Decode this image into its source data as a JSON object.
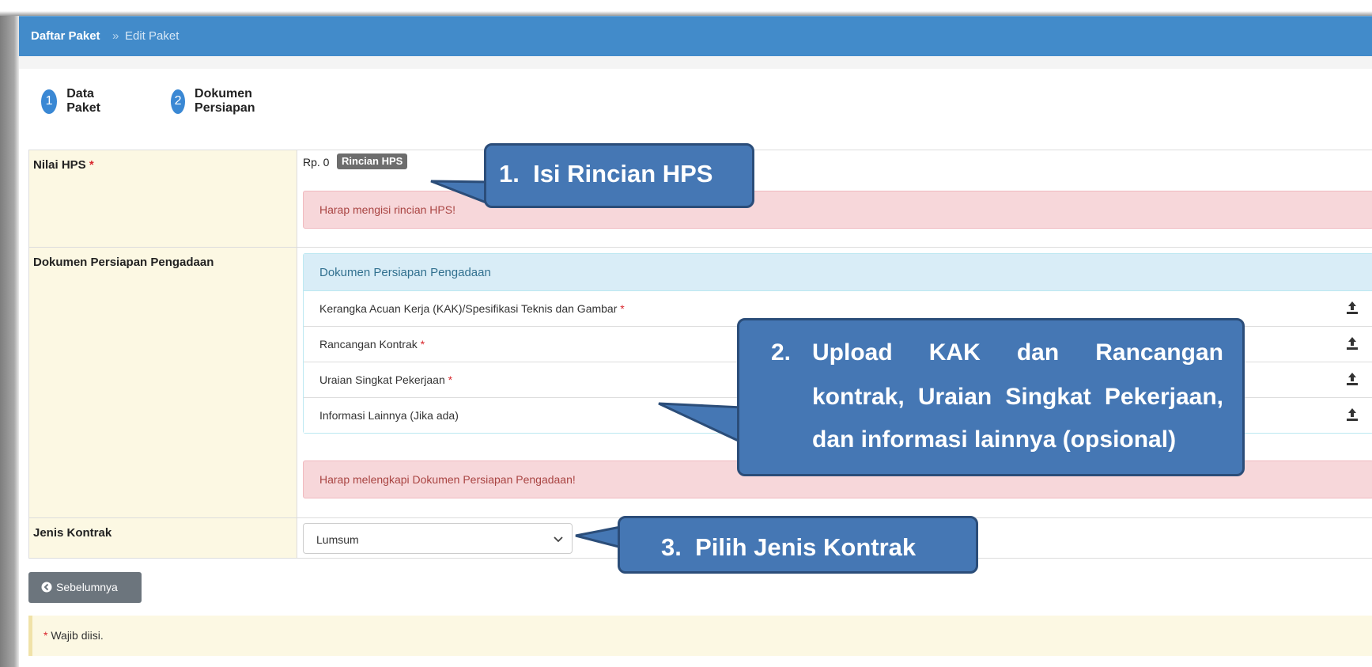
{
  "breadcrumb": {
    "root": "Daftar Paket",
    "separator": "»",
    "current": "Edit Paket"
  },
  "steps": [
    {
      "number": "1",
      "label": "Data Paket"
    },
    {
      "number": "2",
      "label": "Dokumen Persiapan"
    }
  ],
  "nilai_hps": {
    "label": "Nilai HPS",
    "required_mark": "*",
    "value": "Rp. 0",
    "button_label": "Rincian HPS",
    "error": "Harap mengisi rincian HPS!"
  },
  "dokumen": {
    "label": "Dokumen Persiapan Pengadaan",
    "panel_title": "Dokumen Persiapan Pengadaan",
    "items": [
      {
        "label": "Kerangka Acuan Kerja (KAK)/Spesifikasi Teknis dan Gambar",
        "required_mark": "*"
      },
      {
        "label": "Rancangan Kontrak",
        "required_mark": "*"
      },
      {
        "label": "Uraian Singkat Pekerjaan",
        "required_mark": "*"
      },
      {
        "label": "Informasi Lainnya (Jika ada)",
        "required_mark": ""
      }
    ],
    "error": "Harap melengkapi Dokumen Persiapan Pengadaan!"
  },
  "jenis_kontrak": {
    "label": "Jenis Kontrak",
    "selected": "Lumsum"
  },
  "prev_button": {
    "label": "Sebelumnya"
  },
  "note": {
    "required_mark": "*",
    "text": "Wajib diisi."
  },
  "callouts": {
    "c1": "1.  Isi Rincian HPS",
    "c2_number": "2.",
    "c2_line1": [
      "Upload",
      "KAK",
      "dan",
      "Rancangan"
    ],
    "c2_line2": [
      "kontrak,",
      "Uraian",
      "Singkat",
      "Pekerjaan,"
    ],
    "c2_line3": "dan informasi lainnya (opsional)",
    "c3": "3.  Pilih Jenis Kontrak"
  },
  "colors": {
    "navbar": "#428bca",
    "callout": "#4577b4",
    "danger_bg": "#f7d7da",
    "label_bg": "#fcf8e3"
  }
}
